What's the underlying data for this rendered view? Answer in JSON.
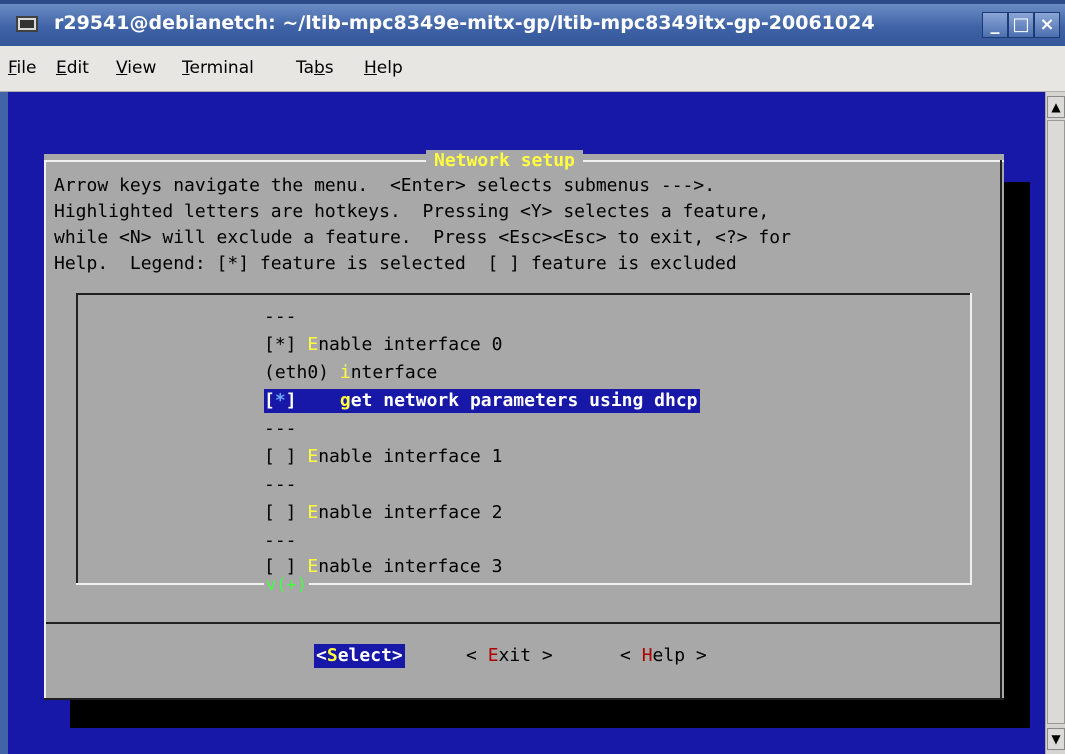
{
  "window": {
    "title": "r29541@debianetch: ~/ltib-mpc8349e-mitx-gp/ltib-mpc8349itx-gp-20061024",
    "minimize": "_",
    "maximize": "□",
    "close": "×"
  },
  "menubar": {
    "items": [
      {
        "hotkey": "F",
        "rest": "ile"
      },
      {
        "hotkey": "E",
        "rest": "dit"
      },
      {
        "hotkey": "V",
        "rest": "iew"
      },
      {
        "hotkey": "T",
        "rest": "erminal"
      },
      {
        "pre": "Ta",
        "hotkey": "b",
        "rest": "s"
      },
      {
        "hotkey": "H",
        "rest": "elp"
      }
    ]
  },
  "dialog": {
    "title": " Network setup ",
    "help_lines": [
      "Arrow keys navigate the menu.  <Enter> selects submenus --->.",
      "Highlighted letters are hotkeys.  Pressing <Y> selectes a feature,",
      "while <N> will exclude a feature.  Press <Esc><Esc> to exit, <?> for",
      "Help.  Legend: [*] feature is selected  [ ] feature is excluded"
    ],
    "menu": {
      "sep1": "---",
      "if0_prefix": "[*] ",
      "if0_hot": "E",
      "if0_rest": "nable interface 0",
      "eth0_prefix": "(eth0) ",
      "eth0_hot": "i",
      "eth0_rest": "nterface",
      "dhcp_open": "[",
      "dhcp_star": "*",
      "dhcp_close": "]",
      "dhcp_gap": "    ",
      "dhcp_hot": "g",
      "dhcp_rest": "et network parameters using dhcp",
      "sep2": "---",
      "if1_prefix": "[ ] ",
      "if1_hot": "E",
      "if1_rest": "nable interface 1",
      "sep3": "---",
      "if2_prefix": "[ ] ",
      "if2_hot": "E",
      "if2_rest": "nable interface 2",
      "sep4": "---",
      "if3_prefix": "[ ] ",
      "if3_hot": "E",
      "if3_rest": "nable interface 3",
      "more": "v(+)"
    },
    "buttons": {
      "select_open": "<",
      "select_hot": "S",
      "select_rest": "elect>",
      "exit_pre": "< ",
      "exit_hot": "E",
      "exit_rest": "xit >",
      "help_pre": "< ",
      "help_hot": "H",
      "help_rest": "elp >"
    }
  },
  "scrollbar": {
    "up": "▲",
    "down": "▼"
  }
}
